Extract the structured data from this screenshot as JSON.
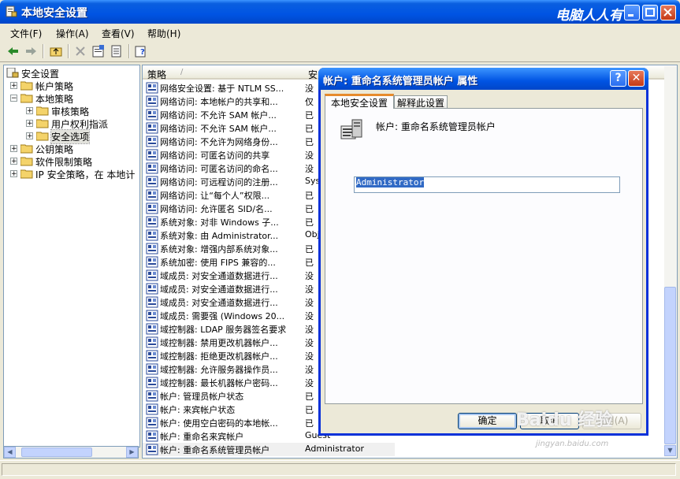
{
  "window": {
    "title": "本地安全设置",
    "watermark": "电脑人人有"
  },
  "menu": [
    "文件(F)",
    "操作(A)",
    "查看(V)",
    "帮助(H)"
  ],
  "tree": [
    {
      "label": "安全设置",
      "level": 0,
      "expander": ""
    },
    {
      "label": "帐户策略",
      "level": 1,
      "expander": "+"
    },
    {
      "label": "本地策略",
      "level": 1,
      "expander": "−"
    },
    {
      "label": "审核策略",
      "level": 2,
      "expander": "+"
    },
    {
      "label": "用户权利指派",
      "level": 2,
      "expander": "+"
    },
    {
      "label": "安全选项",
      "level": 2,
      "expander": "+",
      "selected": true
    },
    {
      "label": "公钥策略",
      "level": 1,
      "expander": "+"
    },
    {
      "label": "软件限制策略",
      "level": 1,
      "expander": "+"
    },
    {
      "label": "IP 安全策略，在 本地计",
      "level": 1,
      "expander": "+"
    }
  ],
  "list": {
    "col_policy": "策略",
    "col_setting": "安",
    "rows": [
      {
        "policy": "网络安全设置: 基于 NTLM SS...",
        "value": "没"
      },
      {
        "policy": "网络访问: 本地帐户的共享和...",
        "value": "仅"
      },
      {
        "policy": "网络访问: 不允许 SAM 帐户...",
        "value": "已"
      },
      {
        "policy": "网络访问: 不允许 SAM 帐户...",
        "value": "已"
      },
      {
        "policy": "网络访问: 不允许为网络身份...",
        "value": "已"
      },
      {
        "policy": "网络访问: 可匿名访问的共享",
        "value": "没"
      },
      {
        "policy": "网络访问: 可匿名访问的命名...",
        "value": "没"
      },
      {
        "policy": "网络访问: 可远程访问的注册...",
        "value": "Sys"
      },
      {
        "policy": "网络访问: 让“每个人”权限...",
        "value": "已"
      },
      {
        "policy": "网络访问: 允许匿名 SID/名...",
        "value": "已"
      },
      {
        "policy": "系统对象: 对非 Windows 子...",
        "value": "已"
      },
      {
        "policy": "系统对象: 由 Administrator...",
        "value": "Obj"
      },
      {
        "policy": "系统对象: 增强内部系统对象...",
        "value": "已"
      },
      {
        "policy": "系统加密: 使用 FIPS 兼容的...",
        "value": "已"
      },
      {
        "policy": "域成员: 对安全通道数据进行...",
        "value": "没"
      },
      {
        "policy": "域成员: 对安全通道数据进行...",
        "value": "没"
      },
      {
        "policy": "域成员: 对安全通道数据进行...",
        "value": "没"
      },
      {
        "policy": "域成员: 需要强 (Windows 20...",
        "value": "没"
      },
      {
        "policy": "域控制器: LDAP 服务器签名要求",
        "value": "没"
      },
      {
        "policy": "域控制器: 禁用更改机器帐户...",
        "value": "没"
      },
      {
        "policy": "域控制器: 拒绝更改机器帐户...",
        "value": "没"
      },
      {
        "policy": "域控制器: 允许服务器操作员...",
        "value": "没"
      },
      {
        "policy": "域控制器: 最长机器帐户密码...",
        "value": "没"
      },
      {
        "policy": "帐户: 管理员帐户状态",
        "value": "已"
      },
      {
        "policy": "帐户: 来宾帐户状态",
        "value": "已"
      },
      {
        "policy": "帐户: 使用空白密码的本地帐...",
        "value": "已"
      },
      {
        "policy": "帐户: 重命名来宾帐户",
        "value": "Guest"
      },
      {
        "policy": "帐户: 重命名系统管理员帐户",
        "value": "Administrator",
        "selected": true
      }
    ]
  },
  "dialog": {
    "title": "帐户: 重命名系统管理员帐户 属性",
    "help_label": "?",
    "close_label": "✕",
    "tab_local": "本地安全设置",
    "tab_explain": "解释此设置",
    "policy_name": "帐户: 重命名系统管理员帐户",
    "value": "Administrator",
    "ok": "确定",
    "cancel": "取消",
    "apply": "应用(A)"
  },
  "overlay": {
    "baidu": "Baidu 经验",
    "baidu_sub": "jingyan.baidu.com"
  }
}
